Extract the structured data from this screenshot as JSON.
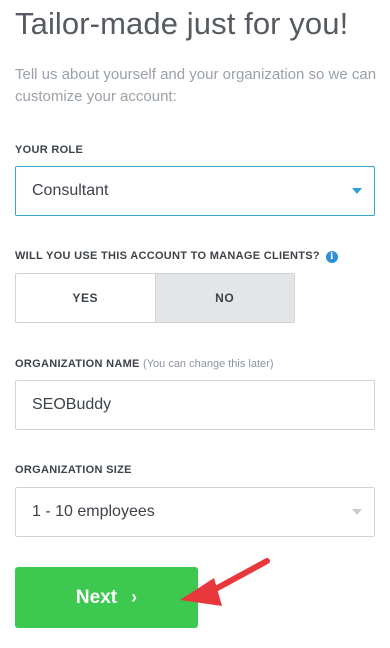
{
  "page": {
    "title": "Tailor-made just for you!",
    "subtitle": "Tell us about yourself and your organization so we can customize your account:"
  },
  "role": {
    "label": "YOUR ROLE",
    "selected": "Consultant"
  },
  "clients": {
    "label": "WILL YOU USE THIS ACCOUNT TO MANAGE CLIENTS?",
    "info_icon": "i",
    "options": [
      "YES",
      "NO"
    ],
    "selected": "NO"
  },
  "organization": {
    "name_label": "ORGANIZATION NAME",
    "name_hint": "(You can change this later)",
    "name_value": "SEOBuddy",
    "size_label": "ORGANIZATION SIZE",
    "size_selected": "1 - 10 employees"
  },
  "actions": {
    "next_label": "Next",
    "next_icon": "›"
  },
  "colors": {
    "accent_blue": "#2f9fd1",
    "button_green": "#3dc84f",
    "annotation_red": "#e8383d"
  }
}
